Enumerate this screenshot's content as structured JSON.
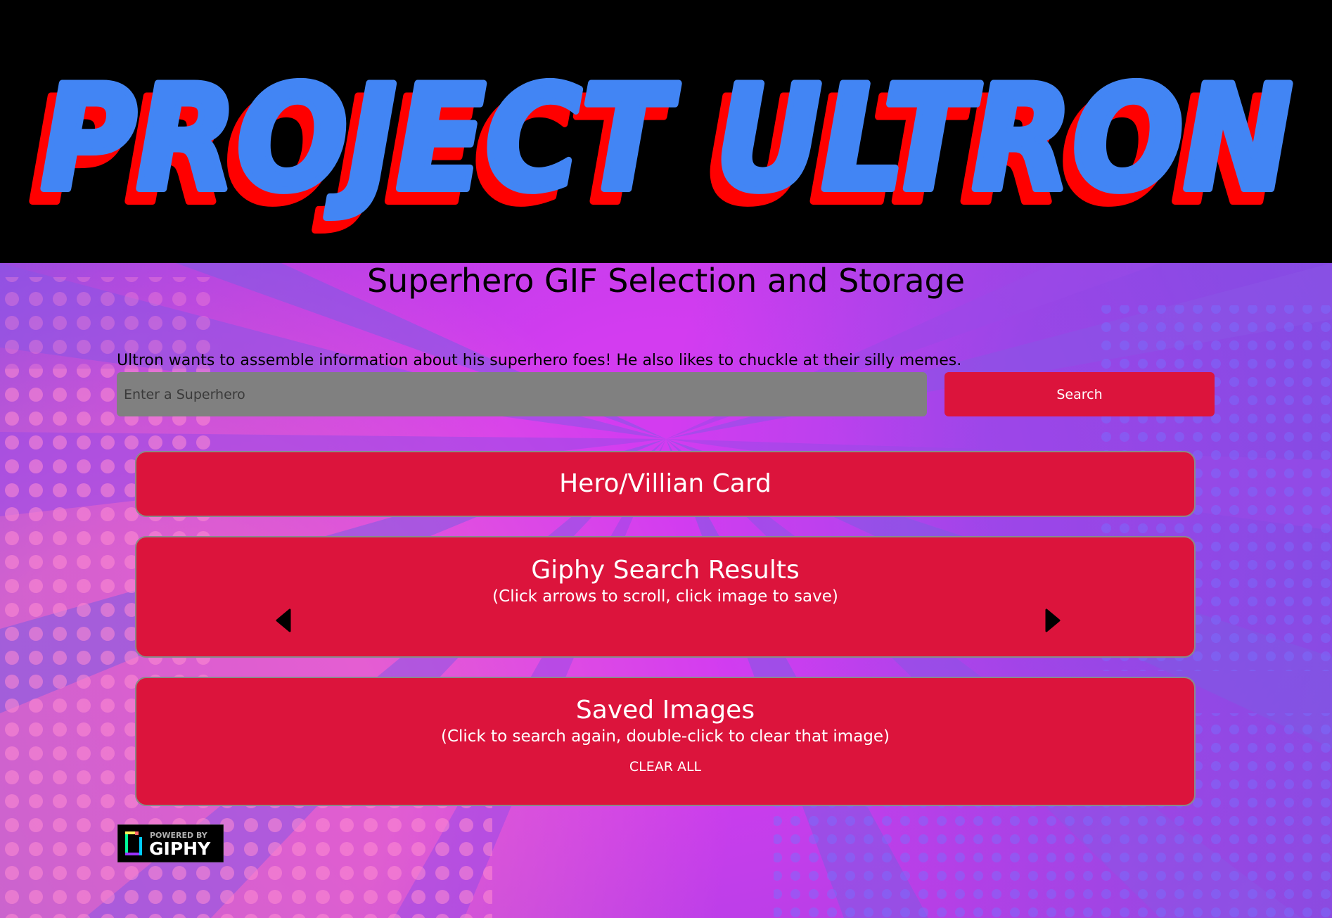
{
  "header": {
    "logo_text": "PROJECT ULTRON"
  },
  "page": {
    "subtitle": "Superhero GIF Selection and Storage",
    "intro": "Ultron wants to assemble information about his superhero foes! He also likes to chuckle at their silly memes."
  },
  "search": {
    "placeholder": "Enter a Superhero",
    "value": "",
    "button_label": "Search"
  },
  "cards": {
    "hero": {
      "title": "Hero/Villian Card"
    },
    "giphy": {
      "title": "Giphy Search Results",
      "subtitle": "(Click arrows to scroll, click image to save)",
      "left_arrow_icon": "caret-left-icon",
      "right_arrow_icon": "caret-right-icon"
    },
    "saved": {
      "title": "Saved Images",
      "subtitle": "(Click to search again, double-click to clear that image)",
      "clear_label": "CLEAR ALL"
    }
  },
  "footer": {
    "badge_small": "POWERED BY",
    "badge_large": "GIPHY"
  },
  "colors": {
    "accent_red": "#dc143c",
    "input_gray": "#808080",
    "logo_blue": "#4285f4",
    "logo_shadow_red": "#ff0000",
    "background_purple": "#b83ee8"
  }
}
